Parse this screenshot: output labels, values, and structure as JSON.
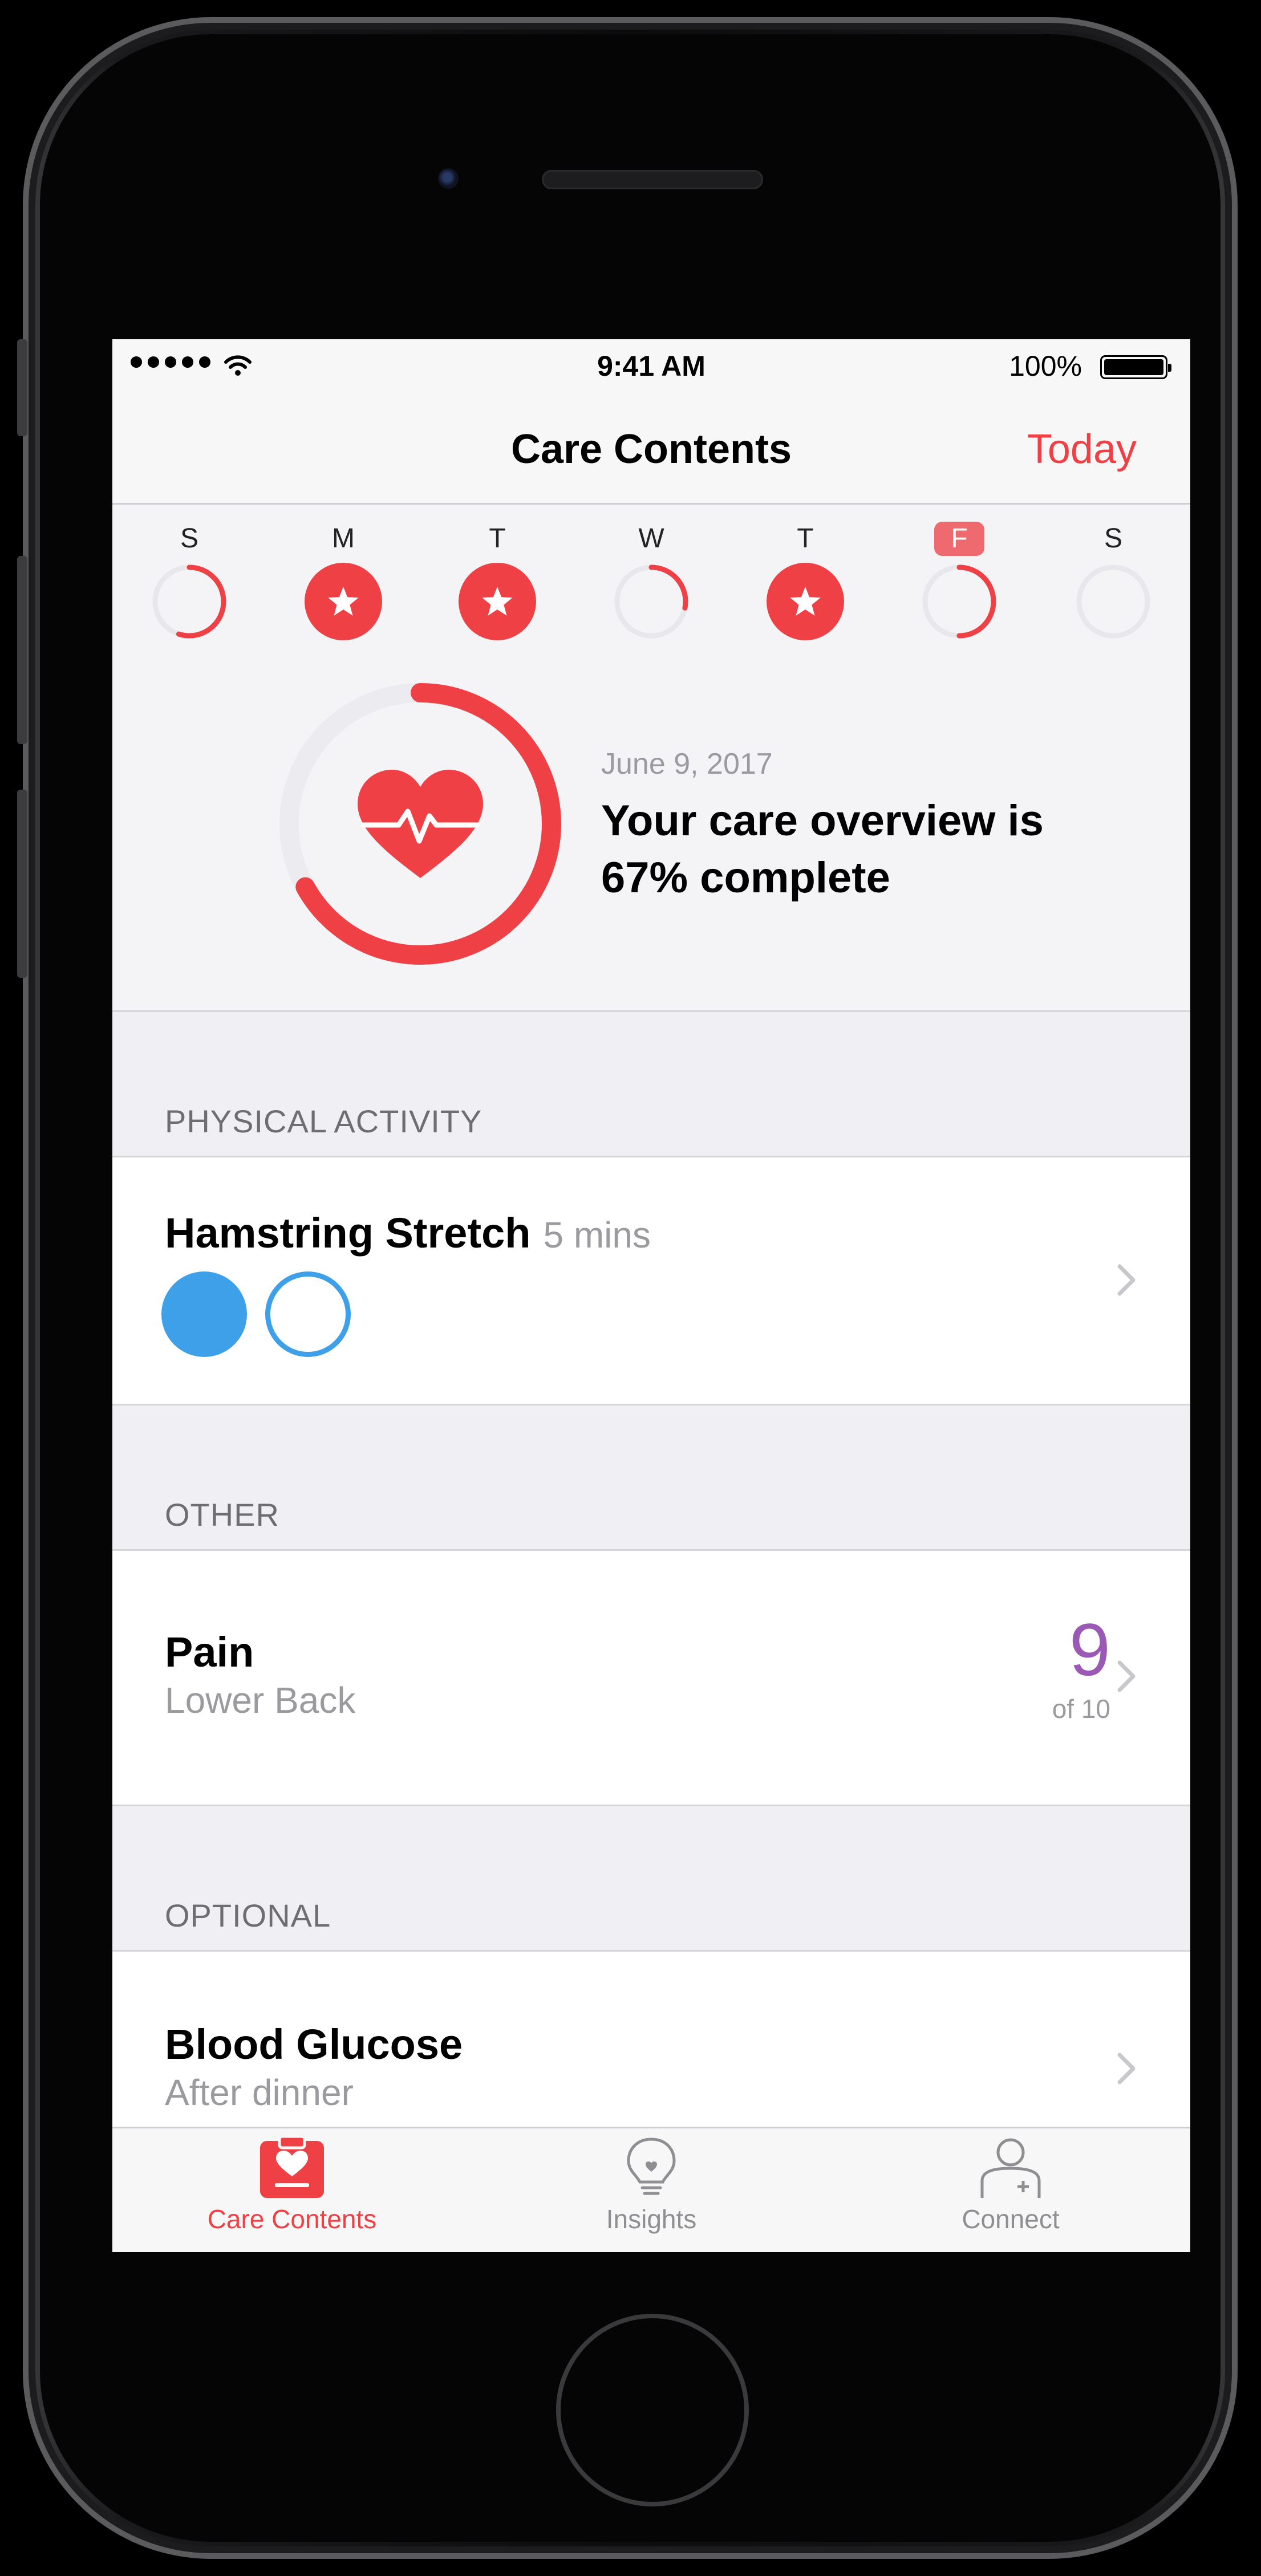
{
  "colors": {
    "accent": "#ef4045",
    "event_blue": "#3fa0ea",
    "pain_purple": "#9b59b6",
    "ring_track": "#e6e6ea"
  },
  "status_bar": {
    "time": "9:41 AM",
    "battery": "100%"
  },
  "nav": {
    "title": "Care Contents",
    "today": "Today"
  },
  "week": [
    {
      "letter": "S",
      "state": "progress",
      "progress": 0.55,
      "today": false
    },
    {
      "letter": "M",
      "state": "complete",
      "progress": 1,
      "today": false
    },
    {
      "letter": "T",
      "state": "complete",
      "progress": 1,
      "today": false
    },
    {
      "letter": "W",
      "state": "progress",
      "progress": 0.28,
      "today": false
    },
    {
      "letter": "T",
      "state": "complete",
      "progress": 1,
      "today": false
    },
    {
      "letter": "F",
      "state": "progress",
      "progress": 0.5,
      "today": true
    },
    {
      "letter": "S",
      "state": "empty",
      "progress": 0,
      "today": false
    }
  ],
  "overview": {
    "progress": 0.67,
    "date": "June 9, 2017",
    "text": "Your care overview is 67% complete"
  },
  "sections": {
    "physical": {
      "title": "PHYSICAL ACTIVITY",
      "item": {
        "title": "Hamstring Stretch",
        "duration": "5 mins",
        "events": [
          true,
          false
        ]
      }
    },
    "other": {
      "title": "OTHER",
      "item": {
        "title": "Pain",
        "subtitle": "Lower Back",
        "value": "9",
        "of": "of 10"
      }
    },
    "optional": {
      "title": "OPTIONAL",
      "item": {
        "title": "Blood Glucose",
        "subtitle": "After dinner"
      }
    }
  },
  "tabs": [
    {
      "label": "Care Contents",
      "icon": "clipboard-heart-icon",
      "active": true
    },
    {
      "label": "Insights",
      "icon": "lightbulb-icon",
      "active": false
    },
    {
      "label": "Connect",
      "icon": "person-plus-icon",
      "active": false
    }
  ]
}
